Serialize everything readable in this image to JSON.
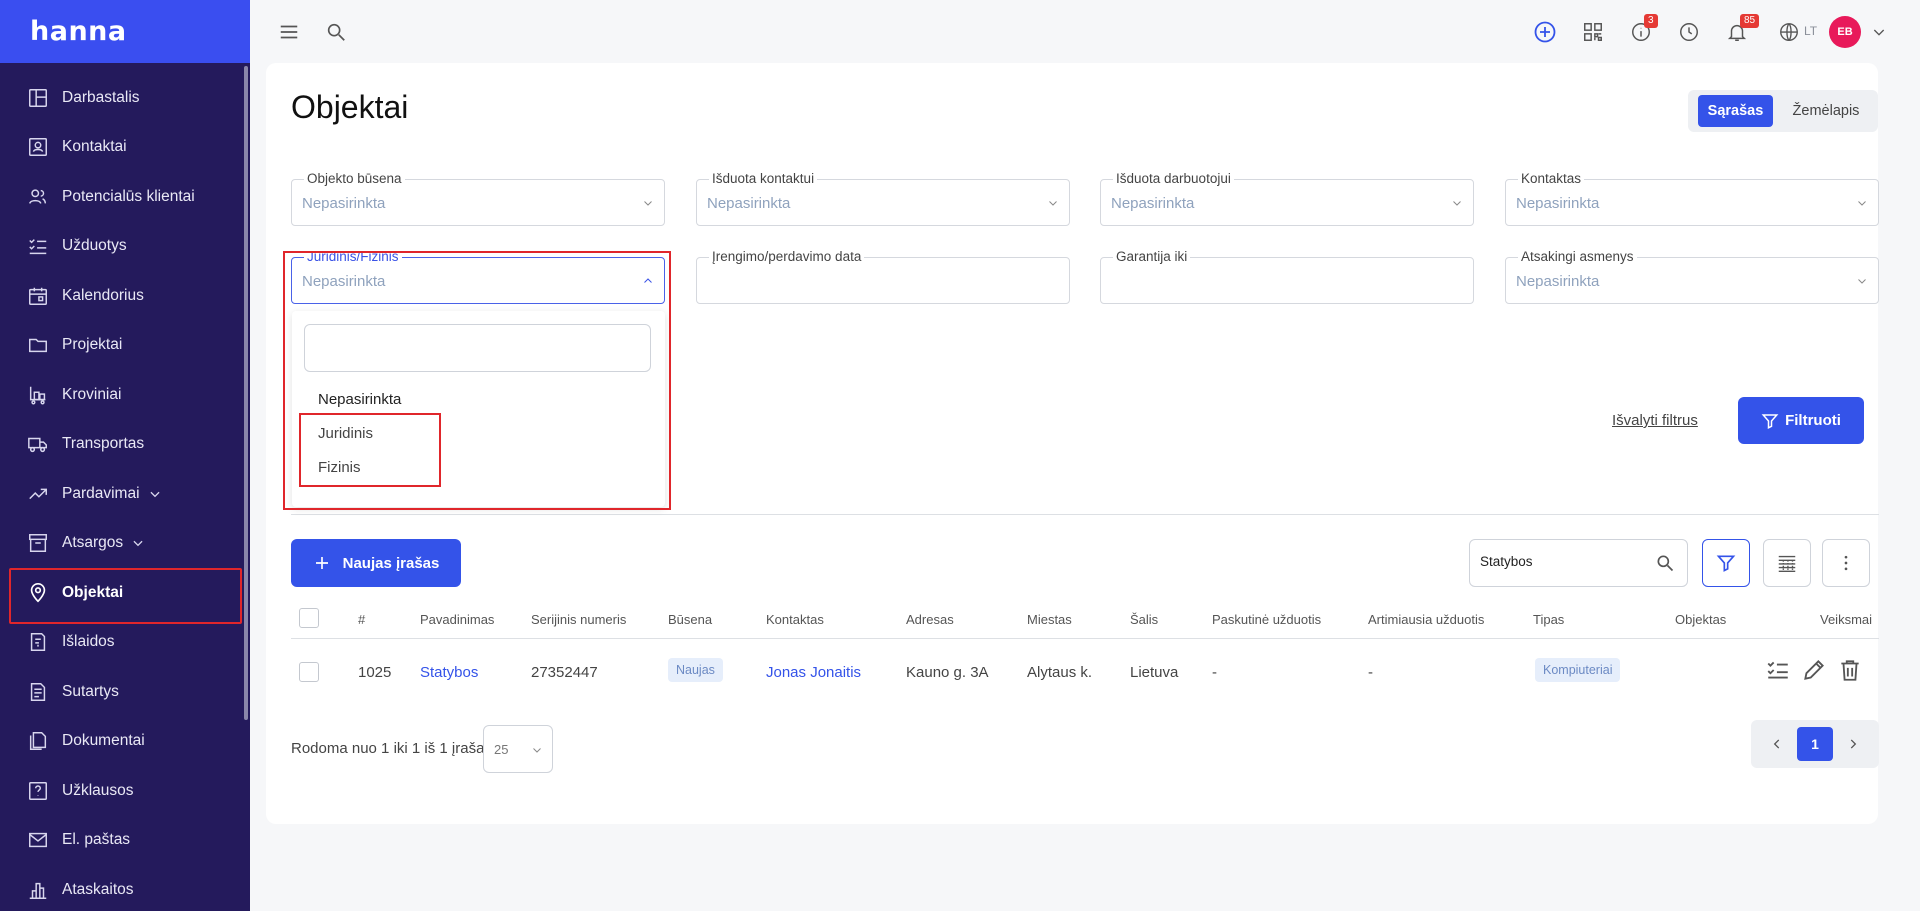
{
  "app": {
    "logo": "hanna"
  },
  "sidebar": {
    "items": [
      {
        "label": "Darbastalis",
        "icon": "dashboard-icon"
      },
      {
        "label": "Kontaktai",
        "icon": "contact-card-icon"
      },
      {
        "label": "Potencialūs klientai",
        "icon": "users-icon"
      },
      {
        "label": "Užduotys",
        "icon": "checklist-icon"
      },
      {
        "label": "Kalendorius",
        "icon": "calendar-icon"
      },
      {
        "label": "Projektai",
        "icon": "folder-icon"
      },
      {
        "label": "Kroviniai",
        "icon": "cargo-icon"
      },
      {
        "label": "Transportas",
        "icon": "truck-icon"
      },
      {
        "label": "Pardavimai",
        "icon": "trend-icon",
        "expandable": true
      },
      {
        "label": "Atsargos",
        "icon": "archive-icon",
        "expandable": true
      },
      {
        "label": "Objektai",
        "icon": "map-pin-icon",
        "active": true
      },
      {
        "label": "Išlaidos",
        "icon": "receipt-icon"
      },
      {
        "label": "Sutartys",
        "icon": "document-icon"
      },
      {
        "label": "Dokumentai",
        "icon": "documents-icon"
      },
      {
        "label": "Užklausos",
        "icon": "question-icon"
      },
      {
        "label": "El. paštas",
        "icon": "mail-icon"
      },
      {
        "label": "Ataskaitos",
        "icon": "bar-chart-icon"
      }
    ]
  },
  "topbar": {
    "info_badge": "3",
    "notifications_badge": "85",
    "language": "LT",
    "avatar_initials": "EB"
  },
  "page": {
    "title": "Objektai",
    "view_toggle": {
      "list": "Sąrašas",
      "map": "Žemėlapis"
    }
  },
  "filters": {
    "object_status": {
      "label": "Objekto būsena",
      "value": "Nepasirinkta"
    },
    "issued_to_contact": {
      "label": "Išduota kontaktui",
      "value": "Nepasirinkta"
    },
    "issued_to_employee": {
      "label": "Išduota darbuotojui",
      "value": "Nepasirinkta"
    },
    "contact": {
      "label": "Kontaktas",
      "value": "Nepasirinkta"
    },
    "legal_physical": {
      "label": "Juridinis/Fizinis",
      "value": "Nepasirinkta"
    },
    "install_date": {
      "label": "Įrengimo/perdavimo data",
      "value": ""
    },
    "warranty_until": {
      "label": "Garantija iki",
      "value": ""
    },
    "responsible": {
      "label": "Atsakingi asmenys",
      "value": "Nepasirinkta"
    },
    "dropdown": {
      "search_value": "",
      "options": [
        "Nepasirinkta",
        "Juridinis",
        "Fizinis"
      ]
    },
    "clear_label": "Išvalyti filtrus",
    "filter_button": "Filtruoti"
  },
  "toolbar": {
    "new_record": "Naujas įrašas",
    "search_value": "Statybos"
  },
  "table": {
    "columns": [
      "#",
      "Pavadinimas",
      "Serijinis numeris",
      "Būsena",
      "Kontaktas",
      "Adresas",
      "Miestas",
      "Šalis",
      "Paskutinė užduotis",
      "Artimiausia užduotis",
      "Tipas",
      "Objektas",
      "Veiksmai"
    ],
    "rows": [
      {
        "id": "1025",
        "name": "Statybos",
        "serial": "27352447",
        "status": "Naujas",
        "contact": "Jonas Jonaitis",
        "address": "Kauno g. 3A",
        "city": "Alytaus k.",
        "country": "Lietuva",
        "last_task": "-",
        "next_task": "-",
        "type": "Kompiuteriai",
        "object": ""
      }
    ]
  },
  "pager": {
    "summary": "Rodoma nuo 1 iki 1 iš 1 įrašai",
    "page_size": "25",
    "current_page": "1"
  },
  "colors": {
    "primary": "#3453e9",
    "sidebar": "#241a5c",
    "highlight": "#e0262b"
  }
}
